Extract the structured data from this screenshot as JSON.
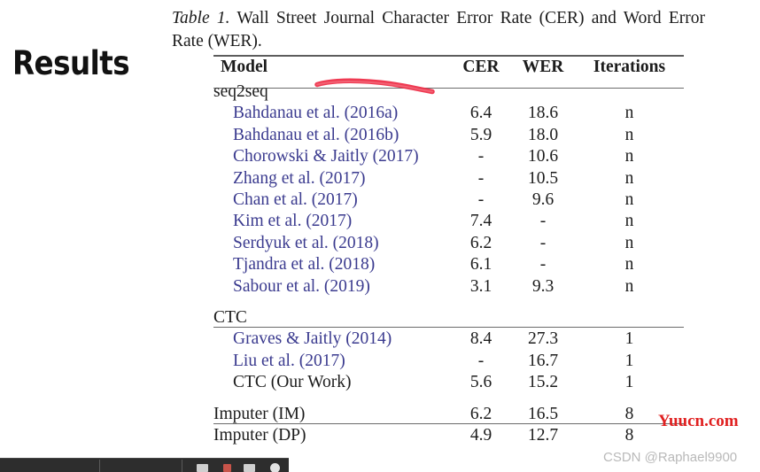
{
  "slide": {
    "heading": "Results"
  },
  "caption": {
    "label": "Table 1.",
    "text": " Wall Street Journal Character Error Rate (CER) and Word Error Rate (WER)."
  },
  "table": {
    "columns": [
      "Model",
      "CER",
      "WER",
      "Iterations"
    ],
    "sections": [
      {
        "group": "seq2seq",
        "rows": [
          {
            "model": "Bahdanau et al. (2016a)",
            "cer": "6.4",
            "wer": "18.6",
            "iterations": "n",
            "style": "citation"
          },
          {
            "model": "Bahdanau et al. (2016b)",
            "cer": "5.9",
            "wer": "18.0",
            "iterations": "n",
            "style": "citation"
          },
          {
            "model": "Chorowski & Jaitly (2017)",
            "cer": "-",
            "wer": "10.6",
            "iterations": "n",
            "style": "citation"
          },
          {
            "model": "Zhang et al. (2017)",
            "cer": "-",
            "wer": "10.5",
            "iterations": "n",
            "style": "citation"
          },
          {
            "model": "Chan et al. (2017)",
            "cer": "-",
            "wer": "9.6",
            "iterations": "n",
            "style": "citation"
          },
          {
            "model": "Kim et al. (2017)",
            "cer": "7.4",
            "wer": "-",
            "iterations": "n",
            "style": "citation"
          },
          {
            "model": "Serdyuk et al. (2018)",
            "cer": "6.2",
            "wer": "-",
            "iterations": "n",
            "style": "citation"
          },
          {
            "model": "Tjandra et al. (2018)",
            "cer": "6.1",
            "wer": "-",
            "iterations": "n",
            "style": "citation"
          },
          {
            "model": "Sabour et al. (2019)",
            "cer": "3.1",
            "wer": "9.3",
            "iterations": "n",
            "style": "citation"
          }
        ]
      },
      {
        "group": "CTC",
        "rows": [
          {
            "model": "Graves & Jaitly (2014)",
            "cer": "8.4",
            "wer": "27.3",
            "iterations": "1",
            "style": "citation"
          },
          {
            "model": "Liu et al. (2017)",
            "cer": "-",
            "wer": "16.7",
            "iterations": "1",
            "style": "citation"
          },
          {
            "model": "CTC (Our Work)",
            "cer": "5.6",
            "wer": "15.2",
            "iterations": "1",
            "style": "plain"
          }
        ]
      },
      {
        "group": null,
        "rows": [
          {
            "model": "Imputer (IM)",
            "cer": "6.2",
            "wer": "16.5",
            "iterations": "8",
            "style": "our"
          },
          {
            "model": "Imputer (DP)",
            "cer": "4.9",
            "wer": "12.7",
            "iterations": "8",
            "style": "our"
          }
        ]
      }
    ]
  },
  "annotations": {
    "pen_stroke_color": "#ee2b45"
  },
  "watermarks": {
    "site": "Yuucn.com",
    "site_color": "#e02020",
    "author": "CSDN @Raphael9900",
    "author_color": "#b9b9b9"
  },
  "colors": {
    "citation_blue": "#3b3b8f",
    "body_text": "#1c1c1c",
    "rule": "#5d5d5d",
    "page_background": "#ffffff",
    "taskbar": "#2d2d2d"
  }
}
